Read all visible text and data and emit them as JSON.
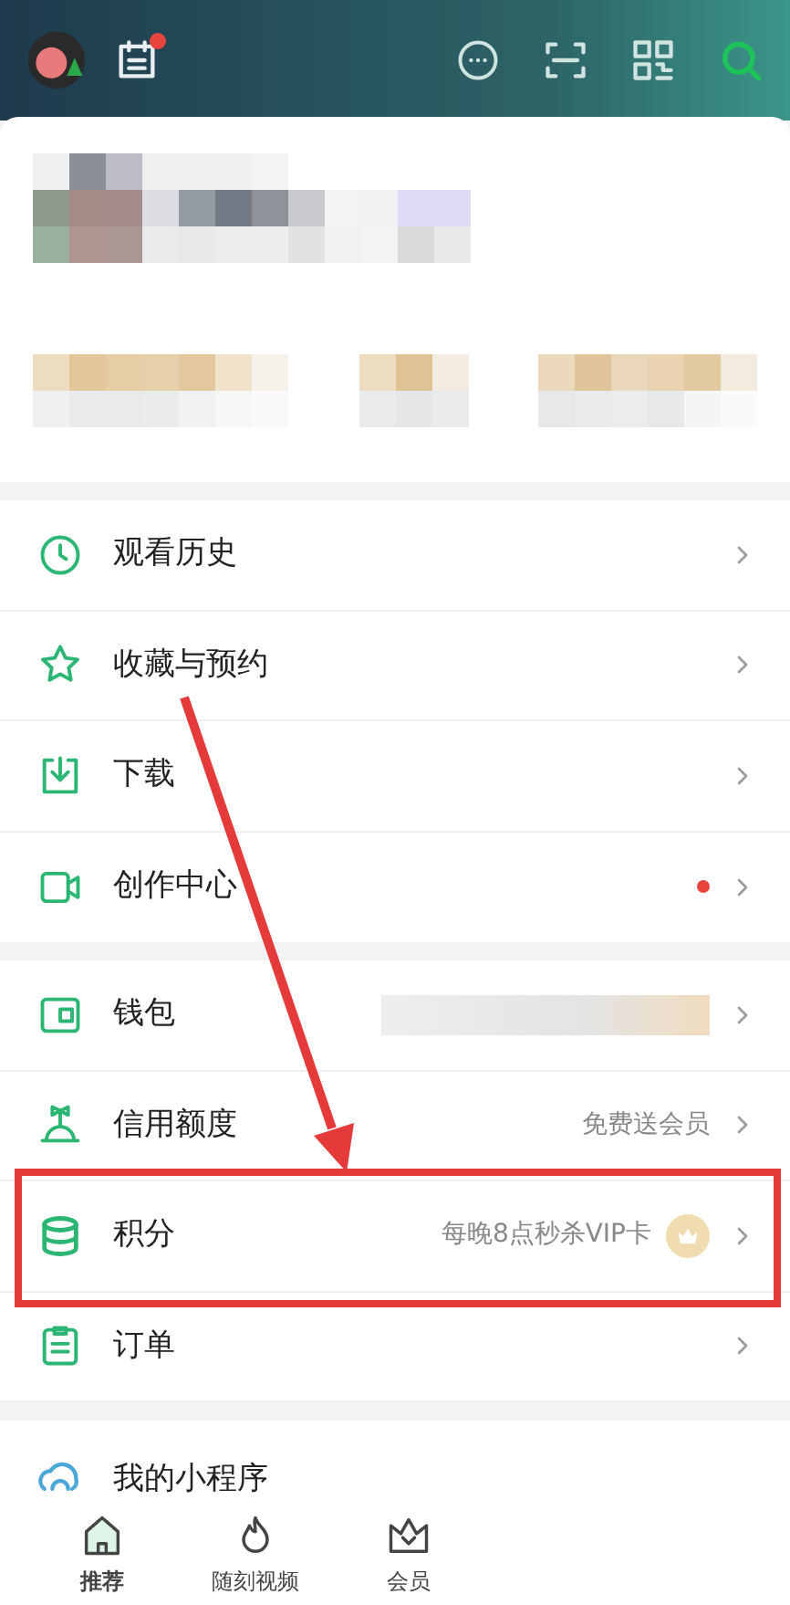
{
  "header": {
    "calendar_badge": true,
    "icons": [
      {
        "kind": "message"
      },
      {
        "kind": "scan"
      },
      {
        "kind": "qrcode"
      },
      {
        "kind": "search"
      }
    ]
  },
  "menu_groups": [
    {
      "items": [
        {
          "kind": "history",
          "label": "观看历史",
          "dot": false,
          "annotated": false
        },
        {
          "kind": "star",
          "label": "收藏与预约",
          "dot": false,
          "annotated": false
        },
        {
          "kind": "download",
          "label": "下载",
          "dot": false,
          "annotated": false
        },
        {
          "kind": "video",
          "label": "创作中心",
          "dot": true,
          "annotated": false
        }
      ]
    },
    {
      "items": [
        {
          "kind": "wallet",
          "label": "钱包",
          "dot": false,
          "annotated": false,
          "redacted": true
        },
        {
          "kind": "credit",
          "label": "信用额度",
          "hint": "免费送会员",
          "dot": false,
          "annotated": false
        },
        {
          "kind": "coins",
          "label": "积分",
          "hint": "每晚8点秒杀VIP卡",
          "crown": true,
          "dot": false,
          "annotated": true
        },
        {
          "kind": "order",
          "label": "订单",
          "dot": false,
          "annotated": false
        }
      ]
    },
    {
      "items": [
        {
          "kind": "miniapp",
          "label": "我的小程序",
          "dot": false,
          "annotated": false
        }
      ]
    }
  ],
  "bottom_nav": [
    {
      "kind": "home",
      "label": "推荐",
      "selected": true
    },
    {
      "kind": "fire",
      "label": "随刻视频",
      "selected": false
    },
    {
      "kind": "crown",
      "label": "会员",
      "selected": false
    }
  ]
}
